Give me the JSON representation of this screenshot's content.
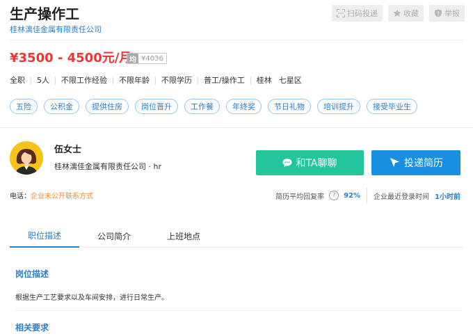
{
  "job": {
    "title": "生产操作工",
    "company": "桂林漓佳金属有限责任公司",
    "salary": "¥3500 - 4500元/月",
    "avg_label": "均",
    "avg_value": "¥4036",
    "meta": [
      "全职",
      "5人",
      "不限工作经验",
      "不限年龄",
      "不限学历",
      "普工/操作工",
      "桂林",
      "七星区"
    ],
    "tags": [
      "五险",
      "公积金",
      "提供住房",
      "岗位晋升",
      "工作餐",
      "年终奖",
      "节日礼物",
      "培训提升",
      "接受毕业生"
    ]
  },
  "actions": {
    "scan_label": "扫码投递",
    "favorite_label": "收藏",
    "report_label": "举报"
  },
  "recruiter": {
    "name": "伍女士",
    "company_role": "桂林漓佳金属有限责任公司 · hr",
    "chat_label": "和TA聊聊",
    "apply_label": "投递简历",
    "phone_label": "电话：",
    "phone_value": "企业未公开联系方式",
    "reply_rate_label": "简历平均回复率",
    "reply_rate_help": "?",
    "reply_rate_value": "92%",
    "last_login_label": "企业最近登录时间",
    "last_login_value": "1小时前"
  },
  "tabs": [
    "职位描述",
    "公司简介",
    "上班地点"
  ],
  "content": {
    "desc_title": "岗位描述",
    "desc_text": "根据生产工艺要求以及车间安排，进行日常生产。",
    "req_title": "相关要求"
  },
  "colors": {
    "accent_blue": "#2c7fc4",
    "salary_red": "#ec3535",
    "chat_green": "#23c69b",
    "apply_blue": "#1a8ee0",
    "warning_orange": "#f08a2e",
    "avatar_yellow": "#f7c21a"
  },
  "icons": {
    "scan": "scan-icon",
    "favorite": "star-icon",
    "report": "shield-icon",
    "chat": "chat-bubble-icon",
    "apply": "send-arrow-icon",
    "avatar": "female-avatar-icon"
  }
}
